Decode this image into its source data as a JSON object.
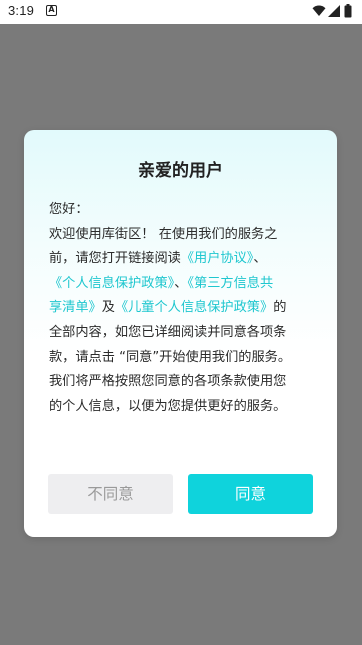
{
  "status_bar": {
    "time": "3:19",
    "app_icon_letter": "A",
    "icons": [
      "wifi-icon",
      "signal-icon",
      "battery-icon"
    ]
  },
  "dialog": {
    "title": "亲爱的用户",
    "greeting": "您好：",
    "segments": {
      "p1": "欢迎使用库街区！ 在使用我们的服务之",
      "p2": "前，请您打开链接阅读",
      "link_user_agreement": "《用户协议》",
      "p3": "、",
      "link_privacy_policy": "《个人信息保护政策》",
      "p4": "、",
      "link_third_party_a": "《第三方信息共",
      "link_third_party_b": "享清单》",
      "p5": "及",
      "link_children_policy": "《儿童个人信息保护政策》",
      "p6": "的",
      "p7": "全部内容，如您已详细阅读并同意各项条",
      "p8": "款，请点击 “同意”开始使用我们的服务。",
      "p9": "我们将严格按照您同意的各项条款使用您",
      "p10": "的个人信息，以便为您提供更好的服务。"
    },
    "buttons": {
      "disagree": "不同意",
      "agree": "同意"
    }
  },
  "colors": {
    "link": "#1fc7cf",
    "agree_button": "#0fd3dc",
    "disagree_button": "#eeeef0",
    "overlay": "#7a7a7a"
  }
}
